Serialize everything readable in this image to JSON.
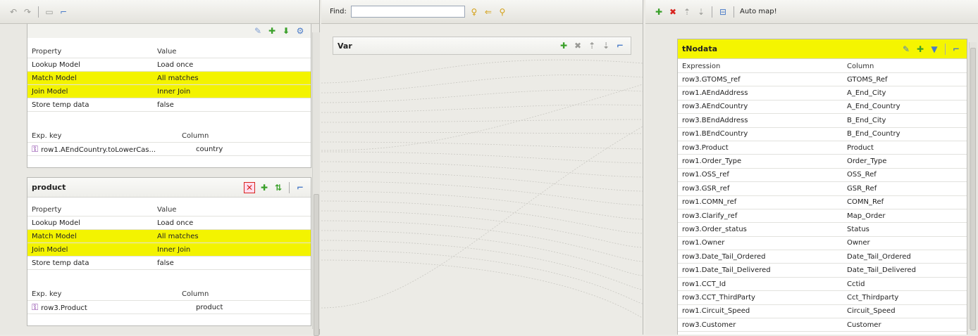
{
  "left_toolbar": {
    "icons": [
      "undo-icon",
      "redo-icon",
      "table-icon",
      "script-icon"
    ]
  },
  "lookup1": {
    "prop_header": [
      "Property",
      "Value"
    ],
    "props": [
      {
        "name": "Lookup Model",
        "value": "Load once",
        "hl": false
      },
      {
        "name": "Match Model",
        "value": "All matches",
        "hl": true
      },
      {
        "name": "Join Model",
        "value": "Inner Join",
        "hl": true
      },
      {
        "name": "Store temp data",
        "value": "false",
        "hl": false
      }
    ],
    "key_header": [
      "Exp. key",
      "Column"
    ],
    "keys": [
      {
        "expr": "row1.AEndCountry.toLowerCas...",
        "column": "country"
      }
    ]
  },
  "product": {
    "title": "product",
    "prop_header": [
      "Property",
      "Value"
    ],
    "props": [
      {
        "name": "Lookup Model",
        "value": "Load once",
        "hl": false
      },
      {
        "name": "Match Model",
        "value": "All matches",
        "hl": true
      },
      {
        "name": "Join Model",
        "value": "Inner Join",
        "hl": true
      },
      {
        "name": "Store temp data",
        "value": "false",
        "hl": false
      }
    ],
    "key_header": [
      "Exp. key",
      "Column"
    ],
    "keys": [
      {
        "expr": "row3.Product",
        "column": "product"
      }
    ]
  },
  "mid_toolbar": {
    "find_label": "Find:",
    "find_value": ""
  },
  "var_panel": {
    "title": "Var"
  },
  "right_toolbar": {
    "automap_label": "Auto map!"
  },
  "output": {
    "title": "tNodata",
    "header": [
      "Expression",
      "Column"
    ],
    "rows": [
      {
        "expr": "row3.GTOMS_ref",
        "col": "GTOMS_Ref"
      },
      {
        "expr": "row1.AEndAddress",
        "col": "A_End_City"
      },
      {
        "expr": "row3.AEndCountry",
        "col": "A_End_Country"
      },
      {
        "expr": "row3.BEndAddress",
        "col": "B_End_City"
      },
      {
        "expr": "row1.BEndCountry",
        "col": "B_End_Country"
      },
      {
        "expr": "row3.Product",
        "col": "Product"
      },
      {
        "expr": "row1.Order_Type",
        "col": "Order_Type"
      },
      {
        "expr": "row1.OSS_ref",
        "col": "OSS_Ref"
      },
      {
        "expr": "row3.GSR_ref",
        "col": "GSR_Ref"
      },
      {
        "expr": "row1.COMN_ref",
        "col": "COMN_Ref"
      },
      {
        "expr": "row3.Clarify_ref",
        "col": "Map_Order"
      },
      {
        "expr": "row3.Order_status",
        "col": "Status"
      },
      {
        "expr": "row1.Owner",
        "col": "Owner"
      },
      {
        "expr": "row3.Date_Tail_Ordered",
        "col": "Date_Tail_Ordered"
      },
      {
        "expr": "row1.Date_Tail_Delivered",
        "col": "Date_Tail_Delivered"
      },
      {
        "expr": "row1.CCT_Id",
        "col": "Cctid"
      },
      {
        "expr": "row3.CCT_ThirdParty",
        "col": "Cct_Thirdparty"
      },
      {
        "expr": "row1.Circuit_Speed",
        "col": "Circuit_Speed"
      },
      {
        "expr": "row3.Customer",
        "col": "Customer"
      }
    ]
  },
  "colors": {
    "highlight": "#f3f300",
    "add": "#3aa02a",
    "delete": "#d8241f"
  }
}
